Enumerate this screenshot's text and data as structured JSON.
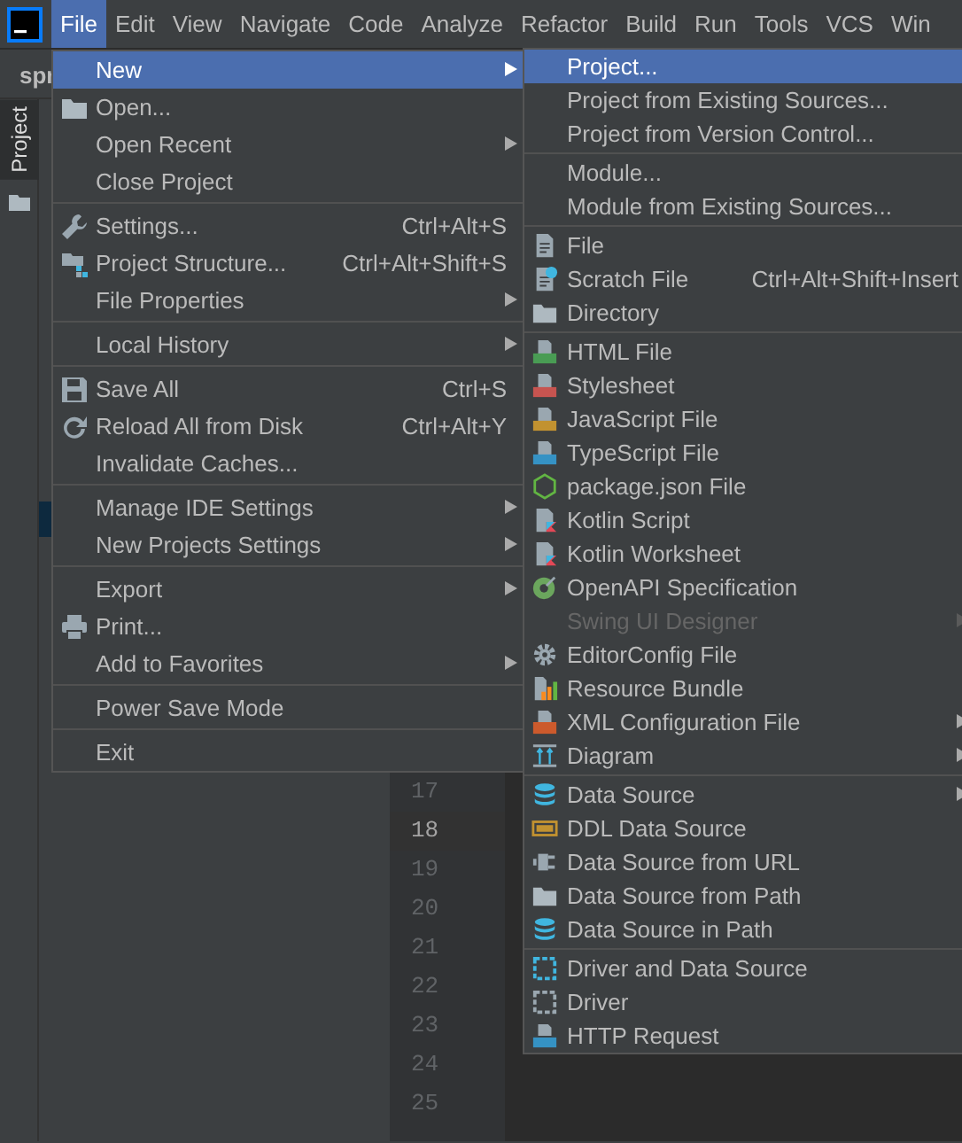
{
  "menu_bar": [
    {
      "label": "File",
      "selected": true
    },
    {
      "label": "Edit",
      "selected": false
    },
    {
      "label": "View",
      "selected": false
    },
    {
      "label": "Navigate",
      "selected": false
    },
    {
      "label": "Code",
      "selected": false
    },
    {
      "label": "Analyze",
      "selected": false
    },
    {
      "label": "Refactor",
      "selected": false
    },
    {
      "label": "Build",
      "selected": false
    },
    {
      "label": "Run",
      "selected": false
    },
    {
      "label": "Tools",
      "selected": false
    },
    {
      "label": "VCS",
      "selected": false
    },
    {
      "label": "Win",
      "selected": false
    }
  ],
  "editor_tab": "spr",
  "tool_window_tab": "Project",
  "line_numbers": [
    {
      "text": "17",
      "current": false
    },
    {
      "text": "18",
      "current": true
    },
    {
      "text": "19",
      "current": false
    },
    {
      "text": "20",
      "current": false
    },
    {
      "text": "21",
      "current": false
    },
    {
      "text": "22",
      "current": false
    },
    {
      "text": "23",
      "current": false
    },
    {
      "text": "24",
      "current": false
    },
    {
      "text": "25",
      "current": false
    }
  ],
  "file_menu": [
    {
      "kind": "item",
      "label": "New",
      "submenu": true,
      "selected": true
    },
    {
      "kind": "item",
      "label": "Open...",
      "selected": false
    },
    {
      "kind": "item",
      "label": "Open Recent",
      "submenu": true,
      "selected": false
    },
    {
      "kind": "item",
      "label": "Close Project",
      "selected": false
    },
    {
      "kind": "separator"
    },
    {
      "kind": "item",
      "label": "Settings...",
      "shortcut": "Ctrl+Alt+S",
      "selected": false
    },
    {
      "kind": "item",
      "label": "Project Structure...",
      "shortcut": "Ctrl+Alt+Shift+S",
      "selected": false
    },
    {
      "kind": "item",
      "label": "File Properties",
      "submenu": true,
      "selected": false
    },
    {
      "kind": "separator"
    },
    {
      "kind": "item",
      "label": "Local History",
      "submenu": true,
      "selected": false
    },
    {
      "kind": "separator"
    },
    {
      "kind": "item",
      "label": "Save All",
      "shortcut": "Ctrl+S",
      "selected": false
    },
    {
      "kind": "item",
      "label": "Reload All from Disk",
      "shortcut": "Ctrl+Alt+Y",
      "selected": false
    },
    {
      "kind": "item",
      "label": "Invalidate Caches...",
      "selected": false
    },
    {
      "kind": "separator"
    },
    {
      "kind": "item",
      "label": "Manage IDE Settings",
      "submenu": true,
      "selected": false
    },
    {
      "kind": "item",
      "label": "New Projects Settings",
      "submenu": true,
      "selected": false
    },
    {
      "kind": "separator"
    },
    {
      "kind": "item",
      "label": "Export",
      "submenu": true,
      "selected": false
    },
    {
      "kind": "item",
      "label": "Print...",
      "selected": false
    },
    {
      "kind": "item",
      "label": "Add to Favorites",
      "submenu": true,
      "selected": false
    },
    {
      "kind": "separator"
    },
    {
      "kind": "item",
      "label": "Power Save Mode",
      "selected": false
    },
    {
      "kind": "separator"
    },
    {
      "kind": "item",
      "label": "Exit",
      "selected": false
    }
  ],
  "new_submenu": [
    {
      "kind": "item",
      "label": "Project...",
      "selected": true
    },
    {
      "kind": "item",
      "label": "Project from Existing Sources...",
      "selected": false
    },
    {
      "kind": "item",
      "label": "Project from Version Control...",
      "selected": false
    },
    {
      "kind": "separator"
    },
    {
      "kind": "item",
      "label": "Module...",
      "selected": false
    },
    {
      "kind": "item",
      "label": "Module from Existing Sources...",
      "selected": false
    },
    {
      "kind": "separator"
    },
    {
      "kind": "item",
      "label": "File",
      "selected": false
    },
    {
      "kind": "item",
      "label": "Scratch File",
      "shortcut": "Ctrl+Alt+Shift+Insert",
      "selected": false
    },
    {
      "kind": "item",
      "label": "Directory",
      "selected": false
    },
    {
      "kind": "separator"
    },
    {
      "kind": "item",
      "label": "HTML File",
      "selected": false
    },
    {
      "kind": "item",
      "label": "Stylesheet",
      "selected": false
    },
    {
      "kind": "item",
      "label": "JavaScript File",
      "selected": false
    },
    {
      "kind": "item",
      "label": "TypeScript File",
      "selected": false
    },
    {
      "kind": "item",
      "label": "package.json File",
      "selected": false
    },
    {
      "kind": "item",
      "label": "Kotlin Script",
      "selected": false
    },
    {
      "kind": "item",
      "label": "Kotlin Worksheet",
      "selected": false
    },
    {
      "kind": "item",
      "label": "OpenAPI Specification",
      "selected": false
    },
    {
      "kind": "item",
      "label": "Swing UI Designer",
      "submenu": true,
      "disabled": true,
      "selected": false
    },
    {
      "kind": "item",
      "label": "EditorConfig File",
      "selected": false
    },
    {
      "kind": "item",
      "label": "Resource Bundle",
      "selected": false
    },
    {
      "kind": "item",
      "label": "XML Configuration File",
      "submenu": true,
      "selected": false
    },
    {
      "kind": "item",
      "label": "Diagram",
      "submenu": true,
      "selected": false
    },
    {
      "kind": "separator"
    },
    {
      "kind": "item",
      "label": "Data Source",
      "submenu": true,
      "selected": false
    },
    {
      "kind": "item",
      "label": "DDL Data Source",
      "selected": false
    },
    {
      "kind": "item",
      "label": "Data Source from URL",
      "selected": false
    },
    {
      "kind": "item",
      "label": "Data Source from Path",
      "selected": false
    },
    {
      "kind": "item",
      "label": "Data Source in Path",
      "selected": false
    },
    {
      "kind": "separator"
    },
    {
      "kind": "item",
      "label": "Driver and Data Source",
      "selected": false
    },
    {
      "kind": "item",
      "label": "Driver",
      "selected": false
    },
    {
      "kind": "item",
      "label": "HTTP Request",
      "selected": false
    }
  ]
}
